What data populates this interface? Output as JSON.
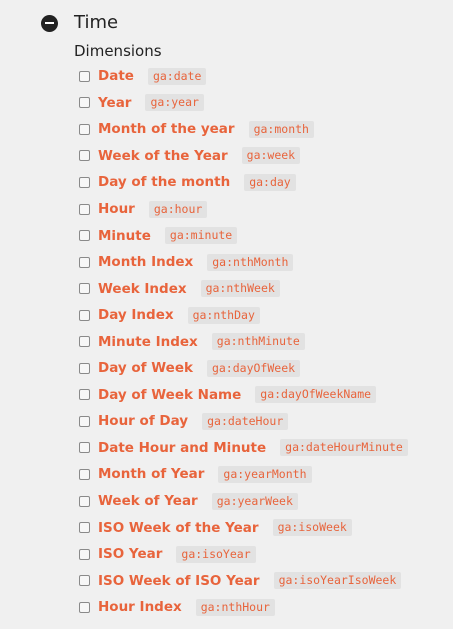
{
  "section": {
    "title": "Time",
    "icon": "minus-circle-icon"
  },
  "group": {
    "title": "Dimensions"
  },
  "colors": {
    "accent": "#e8643c",
    "code_bg": "#e2e2e2",
    "text": "#222222",
    "background": "#f0f0f0"
  },
  "items": [
    {
      "label": "Date",
      "code": "ga:date",
      "checked": false
    },
    {
      "label": "Year",
      "code": "ga:year",
      "checked": false
    },
    {
      "label": "Month of the year",
      "code": "ga:month",
      "checked": false
    },
    {
      "label": "Week of the Year",
      "code": "ga:week",
      "checked": false
    },
    {
      "label": "Day of the month",
      "code": "ga:day",
      "checked": false
    },
    {
      "label": "Hour",
      "code": "ga:hour",
      "checked": false
    },
    {
      "label": "Minute",
      "code": "ga:minute",
      "checked": false
    },
    {
      "label": "Month Index",
      "code": "ga:nthMonth",
      "checked": false
    },
    {
      "label": "Week Index",
      "code": "ga:nthWeek",
      "checked": false
    },
    {
      "label": "Day Index",
      "code": "ga:nthDay",
      "checked": false
    },
    {
      "label": "Minute Index",
      "code": "ga:nthMinute",
      "checked": false
    },
    {
      "label": "Day of Week",
      "code": "ga:dayOfWeek",
      "checked": false
    },
    {
      "label": "Day of Week Name",
      "code": "ga:dayOfWeekName",
      "checked": false
    },
    {
      "label": "Hour of Day",
      "code": "ga:dateHour",
      "checked": false
    },
    {
      "label": "Date Hour and Minute",
      "code": "ga:dateHourMinute",
      "checked": false
    },
    {
      "label": "Month of Year",
      "code": "ga:yearMonth",
      "checked": false
    },
    {
      "label": "Week of Year",
      "code": "ga:yearWeek",
      "checked": false
    },
    {
      "label": "ISO Week of the Year",
      "code": "ga:isoWeek",
      "checked": false
    },
    {
      "label": "ISO Year",
      "code": "ga:isoYear",
      "checked": false
    },
    {
      "label": "ISO Week of ISO Year",
      "code": "ga:isoYearIsoWeek",
      "checked": false
    },
    {
      "label": "Hour Index",
      "code": "ga:nthHour",
      "checked": false
    }
  ]
}
